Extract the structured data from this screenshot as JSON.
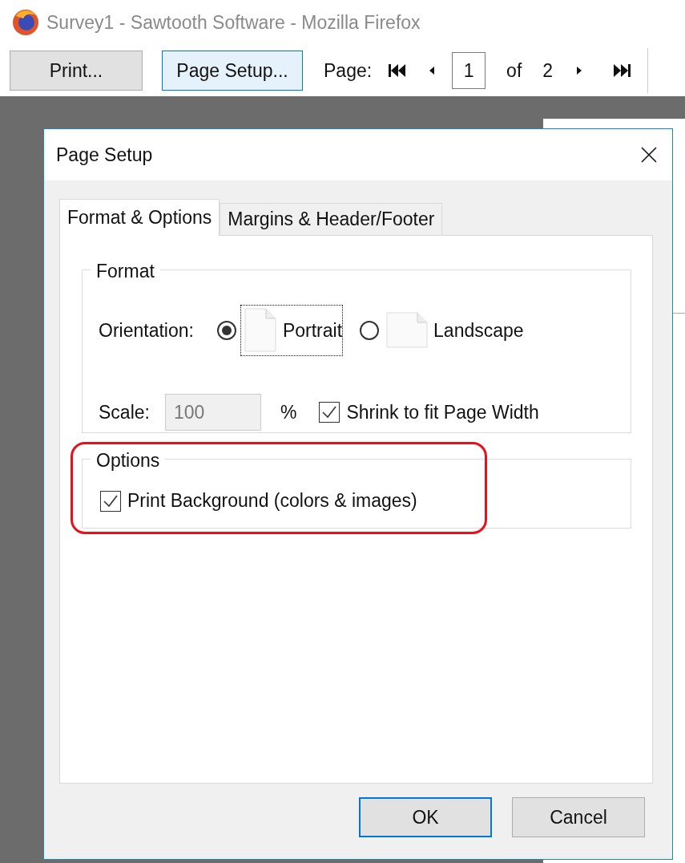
{
  "window": {
    "title": "Survey1 - Sawtooth Software - Mozilla Firefox"
  },
  "toolbar": {
    "print_button": "Print...",
    "page_setup_button": "Page Setup...",
    "page_label": "Page:",
    "page_value": "1",
    "of_label": "of",
    "page_count": "2"
  },
  "dialog": {
    "title": "Page Setup",
    "tabs": [
      {
        "label": "Format & Options",
        "selected": true
      },
      {
        "label": "Margins & Header/Footer",
        "selected": false
      }
    ],
    "format_group": {
      "title": "Format",
      "orientation_label": "Orientation:",
      "orientations": [
        {
          "label": "Portrait",
          "kind": "portrait",
          "selected": true
        },
        {
          "label": "Landscape",
          "kind": "landscape",
          "selected": false
        }
      ],
      "scale_label": "Scale:",
      "scale_value": "100",
      "scale_disabled": true,
      "percent": "%",
      "shrink_label": "Shrink to fit Page Width",
      "shrink_checked": true
    },
    "options_group": {
      "title": "Options",
      "print_background_label": "Print Background (colors & images)",
      "print_background_checked": true,
      "highlighted": true
    },
    "buttons": [
      {
        "label": "OK",
        "default": true
      },
      {
        "label": "Cancel",
        "default": false
      }
    ]
  }
}
